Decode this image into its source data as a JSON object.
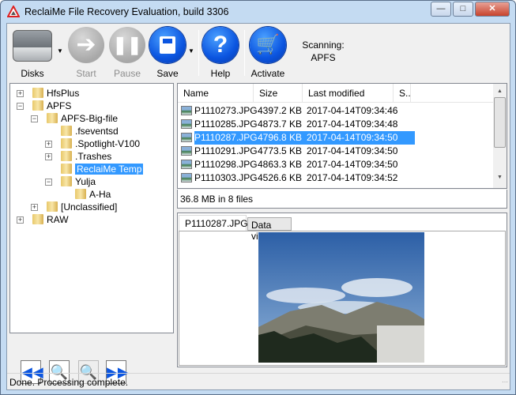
{
  "window": {
    "title": "ReclaiMe File Recovery Evaluation, build 3306",
    "controls": [
      "minimize",
      "maximize",
      "close"
    ]
  },
  "toolbar": {
    "buttons": [
      {
        "label": "Disks",
        "icon": "hard-disk-icon",
        "enabled": true,
        "dropdown": true
      },
      {
        "label": "Start",
        "icon": "arrow-right-icon",
        "enabled": false
      },
      {
        "label": "Pause",
        "icon": "pause-icon",
        "enabled": false
      },
      {
        "label": "Save",
        "icon": "floppy-disk-icon",
        "enabled": true,
        "dropdown": true
      },
      {
        "label": "Help",
        "icon": "question-icon",
        "enabled": true
      },
      {
        "label": "Activate",
        "icon": "shopping-cart-icon",
        "enabled": true
      }
    ],
    "scanning_label": "Scanning:",
    "scanning_value": "APFS"
  },
  "tree": {
    "items": [
      {
        "label": "HfsPlus",
        "level": 0,
        "expander": "+"
      },
      {
        "label": "APFS",
        "level": 0,
        "expander": "-"
      },
      {
        "label": "APFS-Big-file",
        "level": 1,
        "expander": "-"
      },
      {
        "label": ".fseventsd",
        "level": 2,
        "expander": ""
      },
      {
        "label": ".Spotlight-V100",
        "level": 2,
        "expander": "+"
      },
      {
        "label": ".Trashes",
        "level": 2,
        "expander": "+"
      },
      {
        "label": "ReclaiMe Temp",
        "level": 2,
        "expander": "",
        "selected": true
      },
      {
        "label": "Yulja",
        "level": 2,
        "expander": "-"
      },
      {
        "label": "A-Ha",
        "level": 3,
        "expander": ""
      },
      {
        "label": "[Unclassified]",
        "level": 1,
        "expander": "+"
      },
      {
        "label": "RAW",
        "level": 0,
        "expander": "+"
      }
    ]
  },
  "nav_buttons": [
    {
      "icon": "previous-icon"
    },
    {
      "icon": "search-icon"
    },
    {
      "icon": "clear-search-icon",
      "enabled": false
    },
    {
      "icon": "next-icon"
    }
  ],
  "file_list": {
    "columns": [
      "Name",
      "Size",
      "Last modified",
      "S.."
    ],
    "rows": [
      {
        "name": "P1110273.JPG",
        "size": "4397.2 KB",
        "modified": "2017-04-14T09:34:46"
      },
      {
        "name": "P1110285.JPG",
        "size": "4873.7 KB",
        "modified": "2017-04-14T09:34:48"
      },
      {
        "name": "P1110287.JPG",
        "size": "4796.8 KB",
        "modified": "2017-04-14T09:34:50",
        "selected": true
      },
      {
        "name": "P1110291.JPG",
        "size": "4773.5 KB",
        "modified": "2017-04-14T09:34:50"
      },
      {
        "name": "P1110298.JPG",
        "size": "4863.3 KB",
        "modified": "2017-04-14T09:34:50"
      },
      {
        "name": "P1110303.JPG",
        "size": "4526.6 KB",
        "modified": "2017-04-14T09:34:52"
      }
    ],
    "summary": "36.8 MB in 8 files"
  },
  "preview": {
    "tabs": [
      "P1110287.JPG",
      "Data view"
    ],
    "active_tab": 0
  },
  "status": {
    "text": "Done. Processing complete."
  },
  "colors": {
    "selection": "#3399ff",
    "accent": "#0b55e0"
  }
}
